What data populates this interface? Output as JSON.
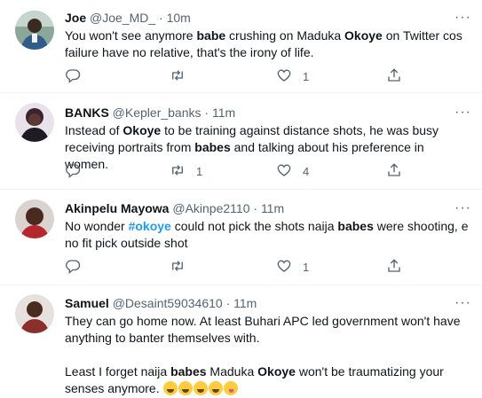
{
  "tweets": [
    {
      "name": "Joe",
      "handle": "@Joe_MD_",
      "separator": "·",
      "time": "10m",
      "text_parts": [
        {
          "t": "You won't see anymore ",
          "s": "n"
        },
        {
          "t": "babe",
          "s": "b"
        },
        {
          "t": " crushing on Maduka ",
          "s": "n"
        },
        {
          "t": "Okoye",
          "s": "b"
        },
        {
          "t": " on Twitter cos failure have no relative, that's the irony of life.",
          "s": "n"
        }
      ],
      "reply_count": "",
      "retweet_count": "",
      "like_count": "1"
    },
    {
      "name": "BANKS",
      "handle": "@Kepler_banks",
      "separator": "·",
      "time": "11m",
      "text_parts": [
        {
          "t": "Instead of ",
          "s": "n"
        },
        {
          "t": "Okoye",
          "s": "b"
        },
        {
          "t": " to be training against distance shots, he was busy receiving portraits from ",
          "s": "n"
        },
        {
          "t": "babes",
          "s": "b"
        },
        {
          "t": " and talking about his preference in women.",
          "s": "n"
        }
      ],
      "reply_count": "",
      "retweet_count": "1",
      "like_count": "4"
    },
    {
      "name": "Akinpelu Mayowa",
      "handle": "@Akinpe2110",
      "separator": "·",
      "time": "11m",
      "text_parts": [
        {
          "t": "No wonder ",
          "s": "n"
        },
        {
          "t": "#okoye",
          "s": "h"
        },
        {
          "t": " could not pick the shots naija ",
          "s": "n"
        },
        {
          "t": "babes",
          "s": "b"
        },
        {
          "t": " were shooting, e no fit pick outside shot",
          "s": "n"
        }
      ],
      "reply_count": "",
      "retweet_count": "",
      "like_count": "1"
    },
    {
      "name": "Samuel",
      "handle": "@Desaint59034610",
      "separator": "·",
      "time": "11m",
      "paragraph1": "They can go home now. At least Buhari APC led government won't have anything to banter themselves with.",
      "text_parts": [
        {
          "t": "Least I forget naija ",
          "s": "n"
        },
        {
          "t": "babes",
          "s": "b"
        },
        {
          "t": " Maduka ",
          "s": "n"
        },
        {
          "t": "Okoye",
          "s": "b"
        },
        {
          "t": " won't be traumatizing your senses anymore. ",
          "s": "n"
        }
      ],
      "emojis": [
        "face-with-tears-of-joy",
        "face-with-tears-of-joy",
        "face-with-tears-of-joy",
        "face-with-tears-of-joy",
        "zany-face"
      ]
    }
  ],
  "icons": {
    "more": "more-horizontal-icon",
    "reply": "reply-icon",
    "retweet": "retweet-icon",
    "like": "like-icon",
    "share": "share-icon"
  },
  "more_glyph": "···",
  "colors": {
    "text": "#0f1419",
    "secondary": "#536471",
    "link": "#1d9bf0",
    "divider": "#eff3f4"
  }
}
